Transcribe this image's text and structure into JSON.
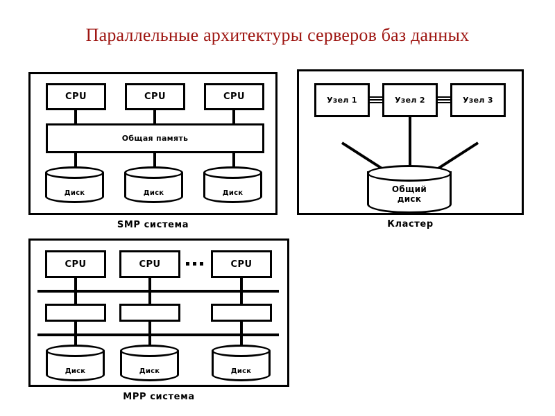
{
  "slide": {
    "title": "Параллельные архитектуры серверов баз данных",
    "title_color": "#9e1612",
    "background_color": "#ffffff",
    "line_color": "#000000"
  },
  "diagrams": [
    {
      "id": "smp",
      "caption": "SMP система",
      "cpus": [
        {
          "label": "CPU"
        },
        {
          "label": "CPU"
        },
        {
          "label": "CPU"
        }
      ],
      "memory_bar": {
        "label": "Общая память"
      },
      "disks": [
        {
          "label": "Диск"
        },
        {
          "label": "Диск"
        },
        {
          "label": "Диск"
        }
      ]
    },
    {
      "id": "cluster",
      "caption": "Кластер",
      "nodes": [
        {
          "label": "Узел 1"
        },
        {
          "label": "Узел 2"
        },
        {
          "label": "Узел 3"
        }
      ],
      "shared_disk": {
        "label_line1": "Общий",
        "label_line2": "диск"
      }
    },
    {
      "id": "mpp",
      "caption": "MPP система",
      "cpus": [
        {
          "label": "CPU"
        },
        {
          "label": "CPU"
        },
        {
          "label": "CPU"
        }
      ],
      "ellipsis": "• • •",
      "memory_boxes": [
        {
          "label": ""
        },
        {
          "label": ""
        },
        {
          "label": ""
        }
      ],
      "disks": [
        {
          "label": "Диск"
        },
        {
          "label": "Диск"
        },
        {
          "label": "Диск"
        }
      ]
    }
  ]
}
